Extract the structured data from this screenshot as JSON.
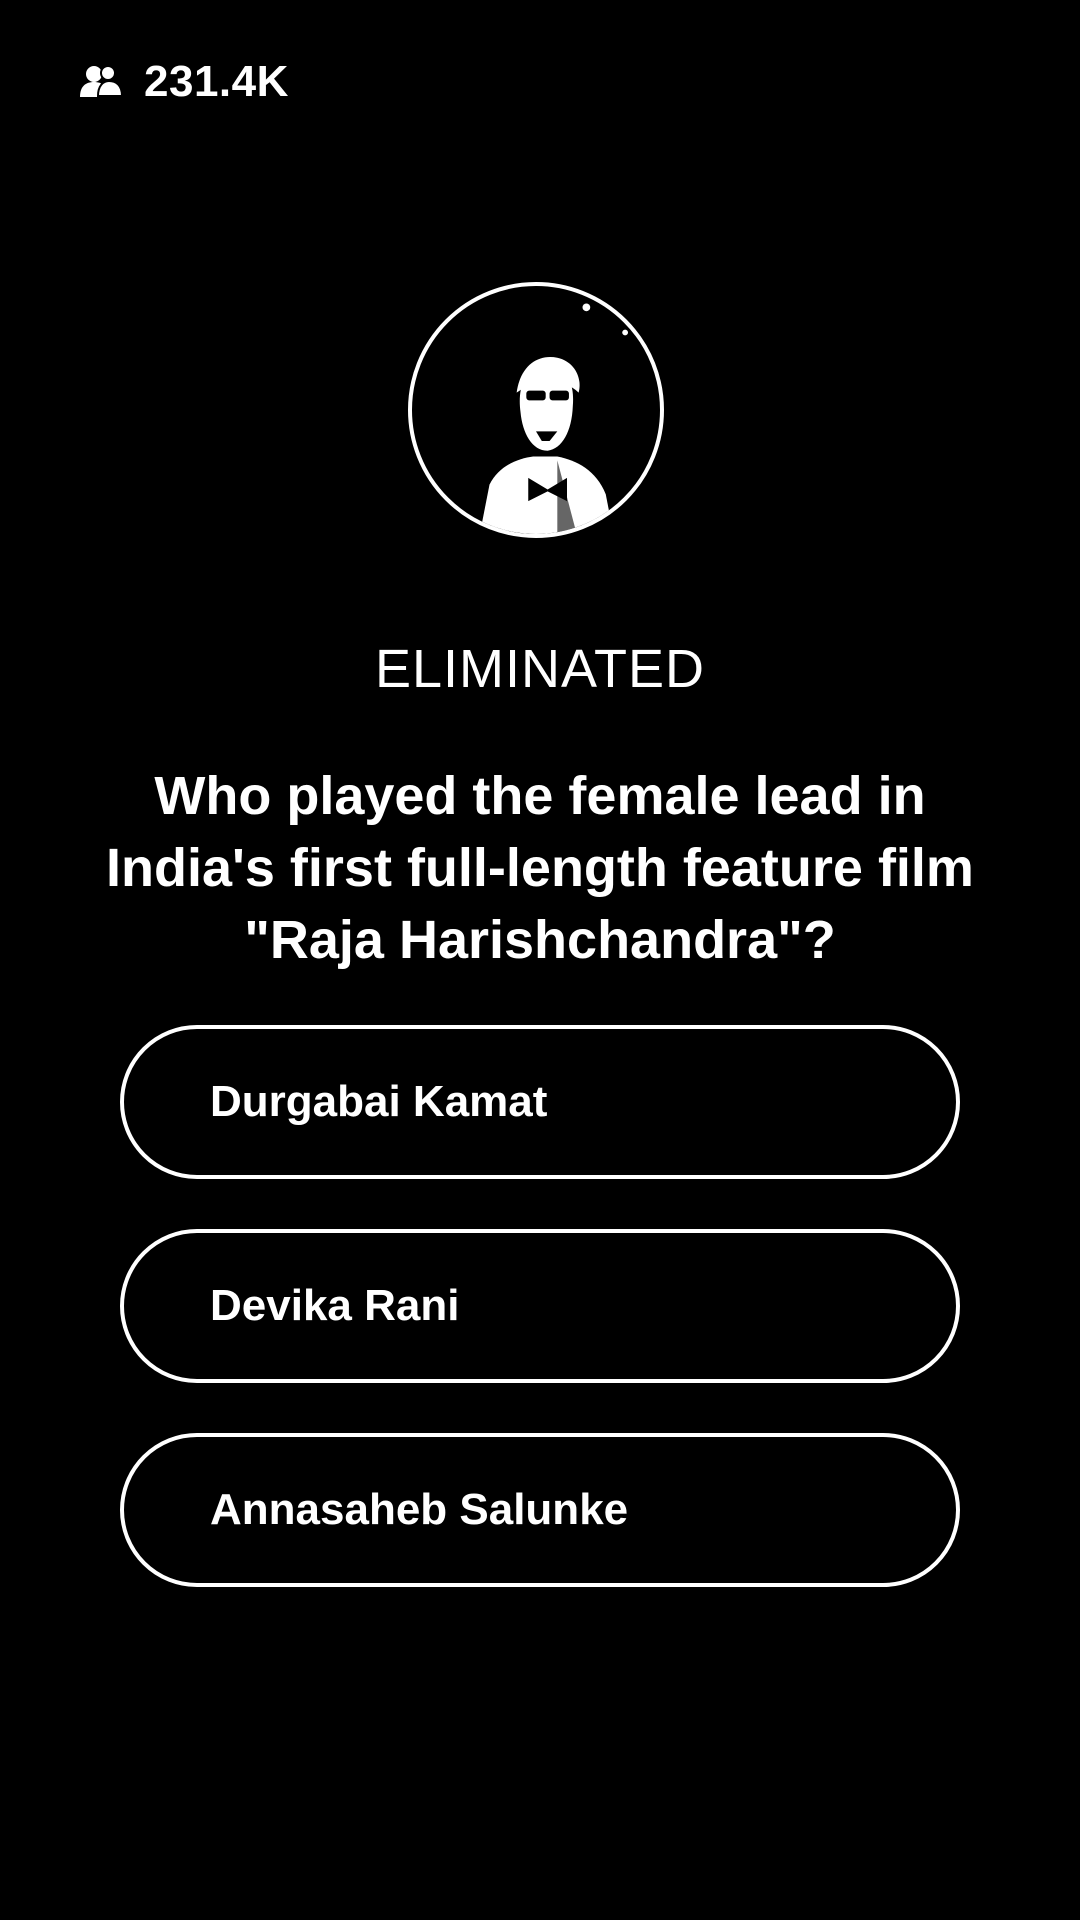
{
  "header": {
    "viewer_icon": "people-icon",
    "viewer_count": "231.4K"
  },
  "host": {
    "avatar_icon": "host-avatar"
  },
  "status": {
    "label": "ELIMINATED"
  },
  "question": {
    "text": "Who played the female lead in India's first full-length feature film \"Raja Harishchandra\"?"
  },
  "options": [
    {
      "label": "Durgabai Kamat"
    },
    {
      "label": "Devika Rani"
    },
    {
      "label": "Annasaheb Salunke"
    }
  ],
  "colors": {
    "background": "#000000",
    "foreground": "#ffffff"
  }
}
